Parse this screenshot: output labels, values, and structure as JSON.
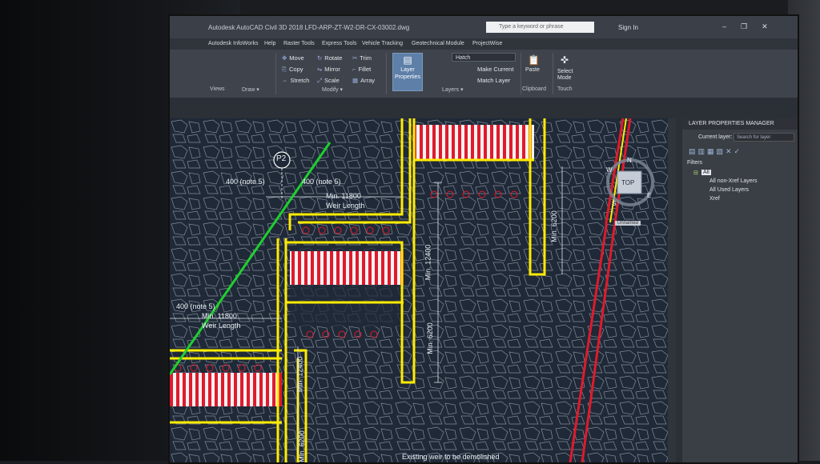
{
  "window": {
    "title": "Autodesk AutoCAD Civil 3D 2018   LFD-ARP-ZT-W2-DR-CX-03002.dwg",
    "search_placeholder": "Type a keyword or phrase",
    "sign_in": "Sign In"
  },
  "menu": [
    "Autodesk InfoWorks",
    "Help",
    "Raster Tools",
    "Express Tools",
    "Vehicle Tracking",
    "Geotechnical Module",
    "ProjectWise"
  ],
  "ribbon": {
    "modify_tools": [
      "Move",
      "Rotate",
      "Trim",
      "Copy",
      "Mirror",
      "Fillet",
      "Stretch",
      "Scale",
      "Array"
    ],
    "layer_properties": "Layer Properties",
    "hatch": "Hatch",
    "make_current": "Make Current",
    "match_layer": "Match Layer",
    "paste": "Paste",
    "select_mode": "Select Mode",
    "panels": {
      "views": "Views",
      "draw": "Draw ▾",
      "modify": "Modify ▾",
      "layers": "Layers ▾",
      "clipboard": "Clipboard",
      "touch": "Touch"
    }
  },
  "drawing": {
    "grid_marker": "P2",
    "annotations": [
      "400 (note 5)",
      "400 (note 5)",
      "Min. 11800",
      "Weir Length",
      "400 (note 5)",
      "Min. 11800",
      "Weir Length",
      "Min. 12400",
      "Min. 6200",
      "Min. 6200",
      "Min. 12400",
      "Min. 6200",
      "Existing weir to be demolished"
    ],
    "viewcube": {
      "top": "TOP",
      "n": "N",
      "w": "W",
      "e": "E",
      "s": "S",
      "tag": "Unnamed"
    }
  },
  "layer_manager": {
    "title": "LAYER PROPERTIES MANAGER",
    "current_layer": "Current layer:",
    "search": "Search for layer",
    "filters": "Filters",
    "tree": [
      "All",
      "All non-Xref Layers",
      "All Used Layers",
      "Xref"
    ]
  }
}
